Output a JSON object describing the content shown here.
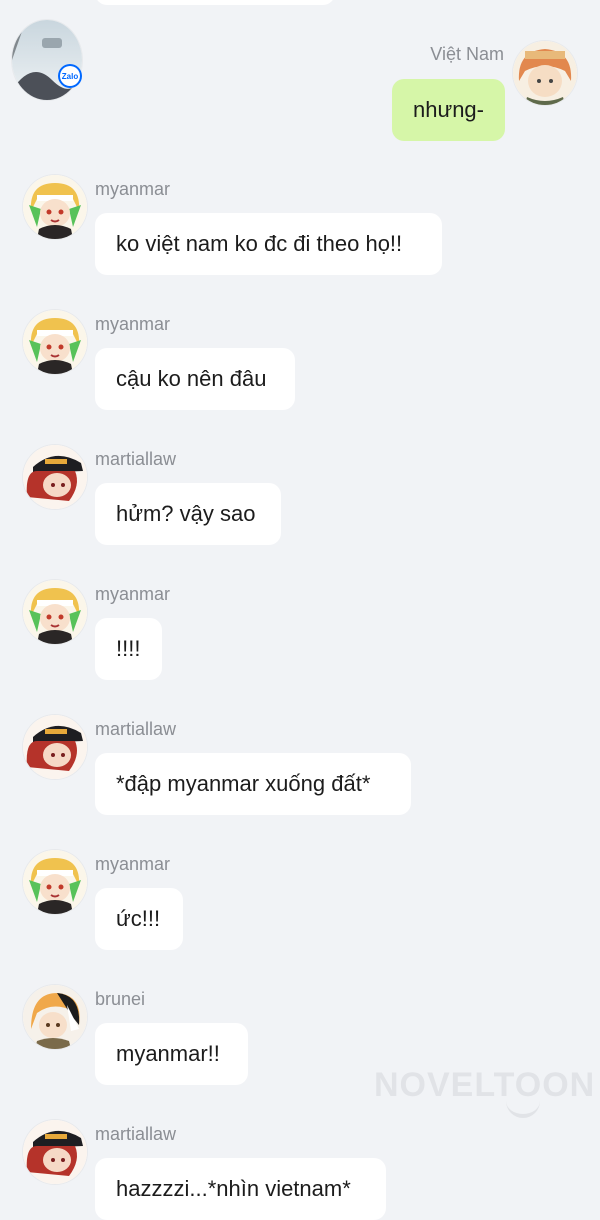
{
  "self_message": {
    "sender": "Việt Nam",
    "text": "nhưng-",
    "bubble_color": "#d6f6a8",
    "avatar_icon": "orange-hair-character-avatar-icon"
  },
  "zalo_badge": "Zalo",
  "messages": [
    {
      "sender": "myanmar",
      "text": "ko việt nam ko đc đi theo họ!!",
      "avatar_icon": "blonde-green-hair-character-avatar-icon"
    },
    {
      "sender": "myanmar",
      "text": "cậu ko nên đâu",
      "avatar_icon": "blonde-green-hair-character-avatar-icon"
    },
    {
      "sender": "martiallaw",
      "text": "hửm? vậy sao",
      "avatar_icon": "red-hair-black-cap-character-avatar-icon"
    },
    {
      "sender": "myanmar",
      "text": "!!!!",
      "avatar_icon": "blonde-green-hair-character-avatar-icon"
    },
    {
      "sender": "martiallaw",
      "text": "*đập myanmar xuống đất*",
      "avatar_icon": "red-hair-black-cap-character-avatar-icon"
    },
    {
      "sender": "myanmar",
      "text": "ức!!!",
      "avatar_icon": "blonde-green-hair-character-avatar-icon"
    },
    {
      "sender": "brunei",
      "text": "myanmar!!",
      "avatar_icon": "black-white-hair-character-avatar-icon"
    },
    {
      "sender": "martiallaw",
      "text": "hazzzzi...*nhìn vietnam*",
      "avatar_icon": "red-hair-black-cap-character-avatar-icon"
    }
  ],
  "watermark": "NOVELTOON",
  "colors": {
    "background": "#f1f3f6",
    "bubble": "#ffffff",
    "sender_name": "#8b8e94"
  }
}
